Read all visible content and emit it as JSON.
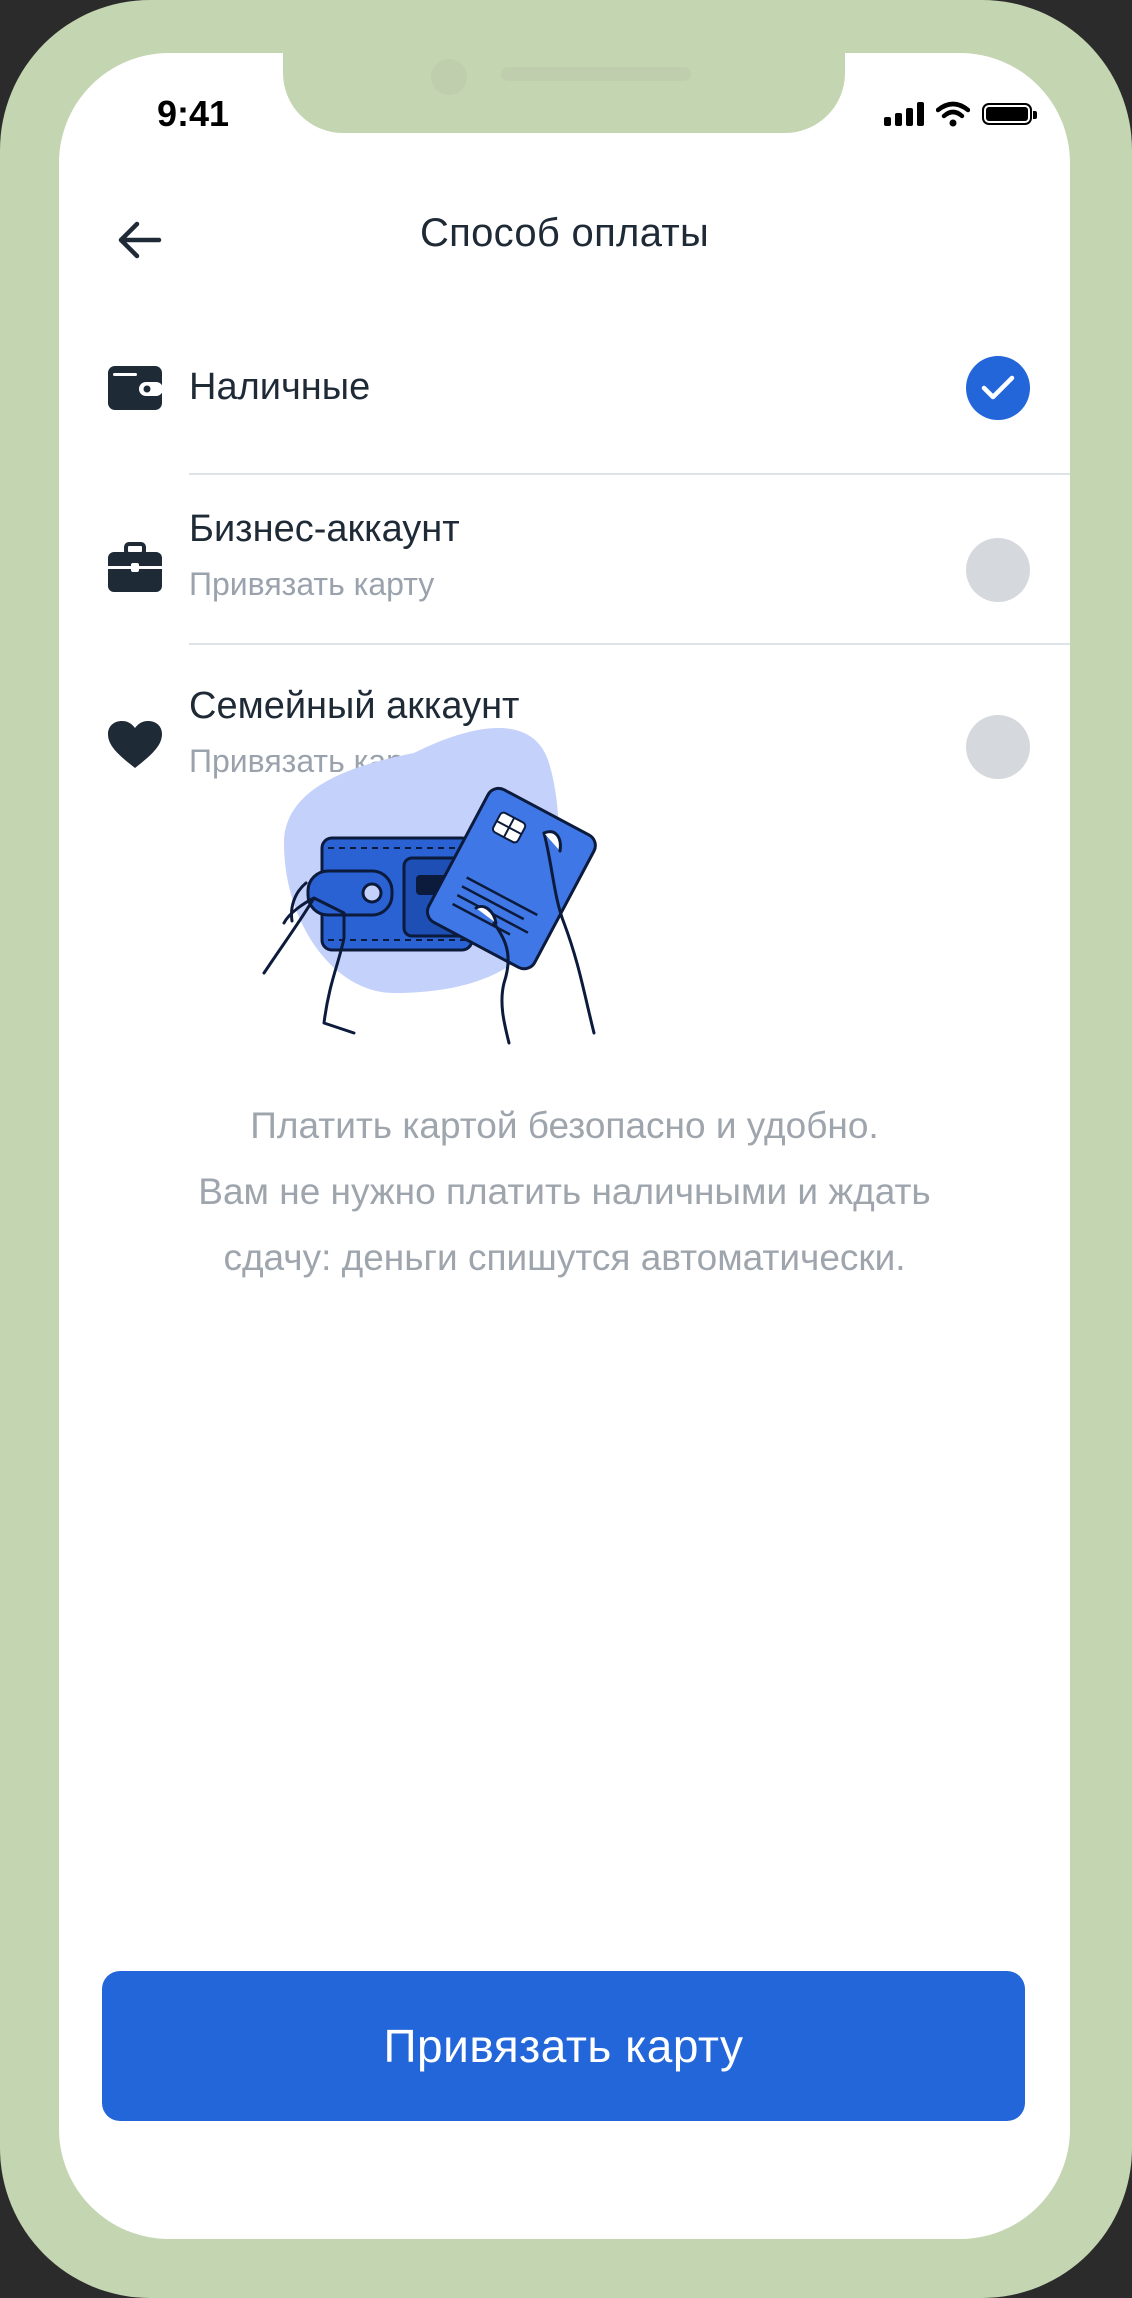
{
  "status_bar": {
    "time": "9:41",
    "icons": [
      "signal-icon",
      "wifi-icon",
      "battery-icon"
    ]
  },
  "header": {
    "back_icon": "arrow-left-icon",
    "title": "Способ оплаты"
  },
  "payment_options": [
    {
      "icon": "wallet-icon",
      "label": "Наличные",
      "subtitle": "",
      "selected": true
    },
    {
      "icon": "briefcase-icon",
      "label": "Бизнес-аккаунт",
      "subtitle": "Привязать карту",
      "selected": false
    },
    {
      "icon": "heart-icon",
      "label": "Семейный аккаунт",
      "subtitle": "Привязать карту",
      "selected": false
    }
  ],
  "illustration": {
    "icon": "hands-wallet-card-illustration"
  },
  "info": {
    "line1": "Платить картой безопасно и удобно.",
    "line2": "Вам не нужно платить наличными и ждать",
    "line3": "сдачу: деньги спишутся автоматически."
  },
  "cta": {
    "label": "Привязать карту"
  },
  "colors": {
    "accent": "#2366d9",
    "frame": "#c3d5b1",
    "text": "#1f2a37",
    "muted": "#9aa3ad",
    "radio_off": "#d5d8dd",
    "blob": "#c4d1fb"
  }
}
